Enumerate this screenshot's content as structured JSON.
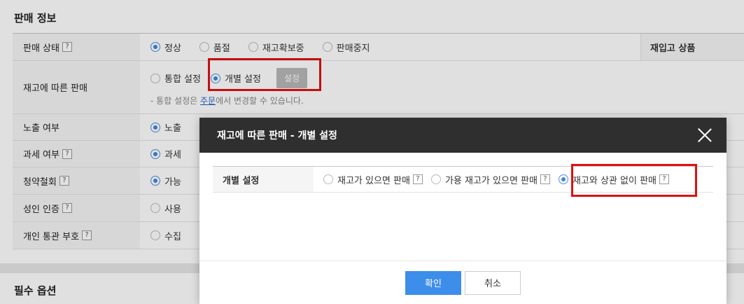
{
  "section_title": "판매 정보",
  "section2_title": "필수 옵션",
  "help_glyph": "?",
  "rows": {
    "sale_status": {
      "label": "판매 상태",
      "options": [
        "정상",
        "품절",
        "재고확보중",
        "판매중지"
      ],
      "selected": "정상"
    },
    "restock_header": "재입고 상품",
    "stock_sale": {
      "label": "재고에 따른 판매",
      "options": [
        "통합 설정",
        "개별 설정"
      ],
      "selected": "개별 설정",
      "button": "설정",
      "note_prefix": "- 통합 설정은 ",
      "note_link": "주문",
      "note_suffix": "에서 변경할 수 있습니다."
    },
    "exposure": {
      "label": "노출 여부",
      "option": "노출"
    },
    "tax": {
      "label": "과세 여부",
      "option": "과세"
    },
    "withdrawal": {
      "label": "청약철회",
      "option": "가능"
    },
    "adult": {
      "label": "성인 인증",
      "option": "사용"
    },
    "customs": {
      "label": "개인 통관 부호",
      "option": "수집"
    }
  },
  "modal": {
    "title": "재고에 따른 판매 - 개별 설정",
    "row_label": "개별 설정",
    "options": [
      "재고가 있으면 판매",
      "가용 재고가 있으면 판매",
      "재고와 상관 없이 판매"
    ],
    "selected": "재고와 상관 없이 판매",
    "confirm": "확인",
    "cancel": "취소"
  },
  "colors": {
    "accent": "#3d8eea",
    "highlight": "#e01010",
    "modal_header": "#2f2f2f"
  }
}
